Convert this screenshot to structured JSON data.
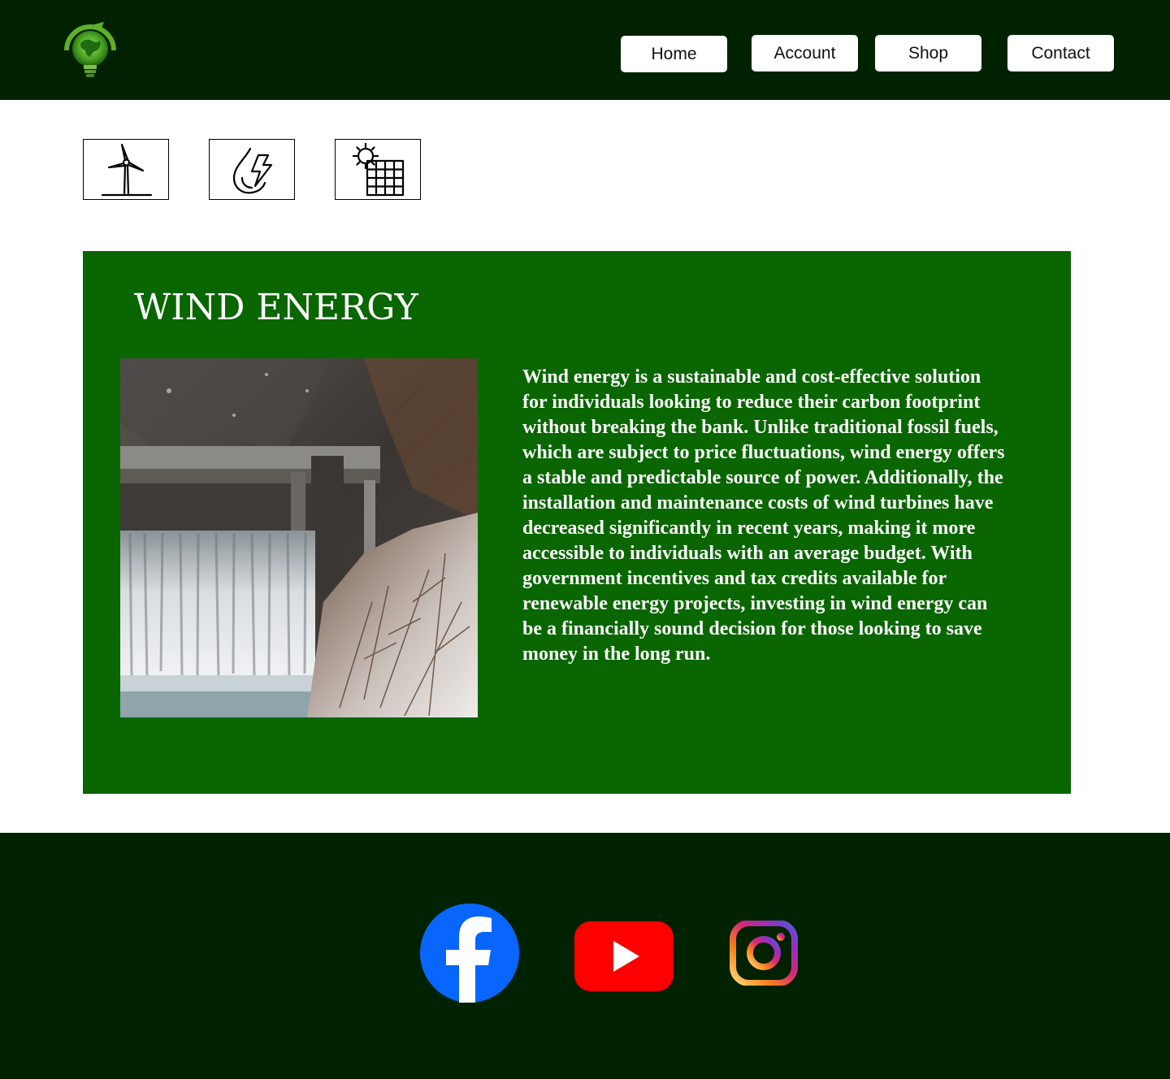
{
  "header": {
    "logo_icon": "lightbulb-globe-logo-icon",
    "nav": [
      {
        "label": "Home"
      },
      {
        "label": "Account"
      },
      {
        "label": "Shop"
      },
      {
        "label": "Contact"
      }
    ]
  },
  "energy_types": [
    {
      "icon": "wind-turbine-icon"
    },
    {
      "icon": "water-drop-lightning-icon"
    },
    {
      "icon": "solar-panel-sun-icon"
    }
  ],
  "article": {
    "title": "WIND ENERGY",
    "image_icon": "waterfall-dam-photo",
    "body": " Wind energy is a sustainable and cost-effective solution for individuals looking to reduce their carbon footprint without breaking the bank. Unlike traditional fossil fuels, which are subject to price fluctuations, wind energy offers a stable and predictable source of power. Additionally, the installation and maintenance costs of wind turbines have decreased significantly in recent years, making it more accessible to individuals with an average budget. With government incentives and tax credits available for renewable energy projects, investing in wind energy can be a financially sound decision for those looking to save money in the long run."
  },
  "footer": {
    "social": [
      {
        "icon": "facebook-icon"
      },
      {
        "icon": "youtube-icon"
      },
      {
        "icon": "instagram-icon"
      }
    ]
  },
  "colors": {
    "header_bg": "#002200",
    "panel_bg": "#096600",
    "facebook": "#0866FF",
    "youtube": "#FF0000"
  }
}
